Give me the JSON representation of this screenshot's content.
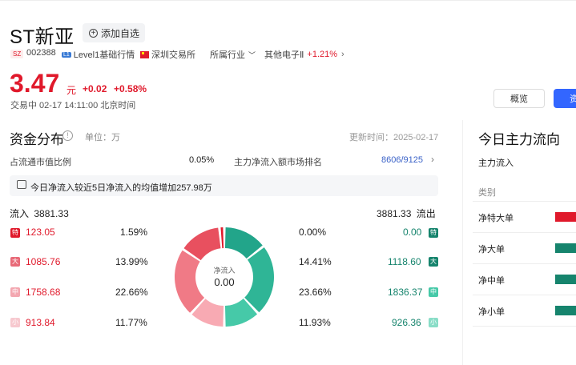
{
  "stock": {
    "name": "ST新亚",
    "add_watch_label": "添加自选",
    "market_tag": "SZ",
    "code": "002388",
    "level_tag": "L1",
    "level_label": "Level1基础行情",
    "exchange": "深圳交易所",
    "industry_label": "所属行业",
    "industry_name": "其他电子Ⅱ",
    "industry_change": "+1.21%"
  },
  "quote": {
    "price": "3.47",
    "unit": "元",
    "change": "+0.02",
    "change_pct": "+0.58%",
    "status_line": "交易中 02-17 14:11:00 北京时间"
  },
  "actions": {
    "overview_label": "概览",
    "blue_label": "资"
  },
  "fund_dist": {
    "title": "资金分布",
    "unit_label": "单位：万",
    "update_label": "更新时间：2025-02-17",
    "float_ratio_label": "占流通市值比例",
    "float_ratio_value": "0.05%",
    "rank_label": "主力净流入额市场排名",
    "rank_value": "8606/9125",
    "banner_text": "今日净流入较近5日净流入的均值增加257.98万",
    "inflow_label": "流入",
    "inflow_total": "3881.33",
    "outflow_total": "3881.33",
    "outflow_label": "流出",
    "center_label": "净流入",
    "center_value": "0.00",
    "rows": [
      {
        "in_badge": "特",
        "in_value": "123.05",
        "in_pct": "1.59%",
        "out_pct": "0.00%",
        "out_value": "0.00",
        "out_badge": "特"
      },
      {
        "in_badge": "大",
        "in_value": "1085.76",
        "in_pct": "13.99%",
        "out_pct": "14.41%",
        "out_value": "1118.60",
        "out_badge": "大"
      },
      {
        "in_badge": "中",
        "in_value": "1758.68",
        "in_pct": "22.66%",
        "out_pct": "23.66%",
        "out_value": "1836.37",
        "out_badge": "中"
      },
      {
        "in_badge": "小",
        "in_value": "913.84",
        "in_pct": "11.77%",
        "out_pct": "11.93%",
        "out_value": "926.36",
        "out_badge": "小"
      }
    ]
  },
  "main_flow": {
    "title": "今日主力流向",
    "header_label": "主力流入",
    "category_label": "类别",
    "categories": [
      "净特大单",
      "净大单",
      "净中单",
      "净小单"
    ]
  },
  "colors": {
    "red": "#e0192b",
    "green": "#16846d",
    "blue": "#3366ff"
  }
}
